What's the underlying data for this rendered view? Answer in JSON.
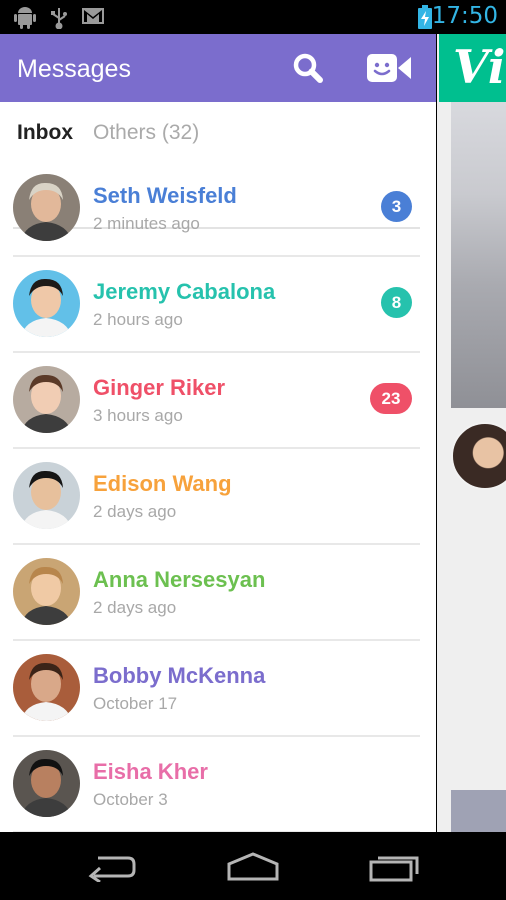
{
  "status_bar": {
    "time": "17:50",
    "icons": [
      "android-debug-icon",
      "usb-icon",
      "gmail-icon",
      "battery-charging-icon"
    ]
  },
  "app_bar": {
    "title": "Messages",
    "icons": [
      "search-icon",
      "video-camera-icon"
    ],
    "color": "#7b6dcd"
  },
  "tabs": [
    {
      "label": "Inbox",
      "selected": true
    },
    {
      "label": "Others (32)",
      "selected": false
    }
  ],
  "conversations": [
    {
      "name": "Seth Weisfeld",
      "time": "2 minutes ago",
      "badge": "3",
      "color": "#4a7fd6",
      "badge_color": "#4a7fd6"
    },
    {
      "name": "Jeremy Cabalona",
      "time": "2 hours ago",
      "badge": "8",
      "color": "#26c2ad",
      "badge_color": "#26c2ad"
    },
    {
      "name": "Ginger Riker",
      "time": "3 hours ago",
      "badge": "23",
      "color": "#ef5068",
      "badge_color": "#ef5068"
    },
    {
      "name": "Edison Wang",
      "time": "2 days ago",
      "badge": "",
      "color": "#f7a23c",
      "badge_color": ""
    },
    {
      "name": "Anna Nersesyan",
      "time": "2 days ago",
      "badge": "",
      "color": "#6cc050",
      "badge_color": ""
    },
    {
      "name": "Bobby McKenna",
      "time": "October 17",
      "badge": "",
      "color": "#7b6dcd",
      "badge_color": ""
    },
    {
      "name": "Eisha Kher",
      "time": "October 3",
      "badge": "",
      "color": "#e86ea8",
      "badge_color": ""
    }
  ],
  "side_panel": {
    "logo": "Vi",
    "color": "#00bf8f"
  },
  "nav_bar": {
    "icons": [
      "back-icon",
      "home-icon",
      "recents-icon"
    ]
  }
}
